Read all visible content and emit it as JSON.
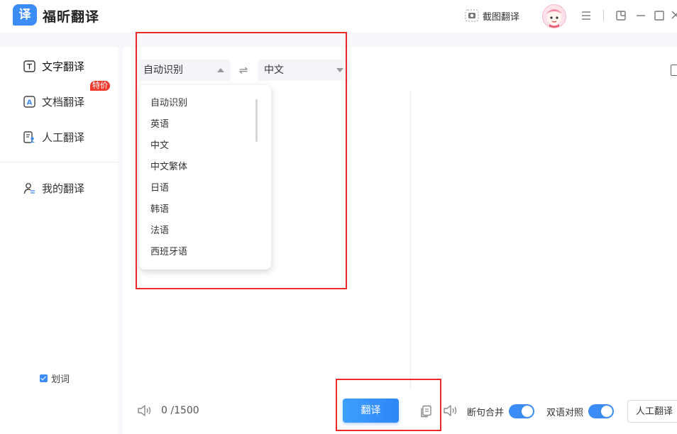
{
  "app": {
    "logo_char": "译",
    "title": "福昕翻译"
  },
  "titlebar": {
    "screenshot_translate": "截图翻译"
  },
  "sidebar": {
    "items": [
      {
        "label": "文字翻译",
        "icon": "text-t-icon"
      },
      {
        "label": "文档翻译",
        "icon": "document-a-icon"
      },
      {
        "label": "人工翻译",
        "icon": "person-document-icon",
        "badge": "特价"
      },
      {
        "label": "我的翻译",
        "icon": "user-arrows-icon"
      }
    ],
    "huaci_label": "划词",
    "huaci_checked": true
  },
  "translator": {
    "source_lang": "自动识别",
    "target_lang": "中文",
    "dropdown_options": [
      "自动识别",
      "英语",
      "中文",
      "中文繁体",
      "日语",
      "韩语",
      "法语",
      "西班牙语"
    ],
    "char_count": "0 /1500",
    "translate_button": "翻译",
    "toggles": [
      {
        "label": "断句合并",
        "on": true
      },
      {
        "label": "双语对照",
        "on": true
      }
    ],
    "human_translate_button": "人工翻译"
  },
  "colors": {
    "accent": "#3b8cf6",
    "highlight_red": "#ec2a2a",
    "badge_red": "#f03b2e"
  }
}
